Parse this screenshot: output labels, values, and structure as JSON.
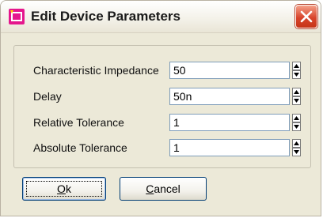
{
  "window": {
    "title": "Edit Device Parameters",
    "close_icon": "close-icon",
    "app_icon": "app-icon"
  },
  "fields": [
    {
      "label": "Characteristic Impedance",
      "value": "50"
    },
    {
      "label": "Delay",
      "value": "50n"
    },
    {
      "label": "Relative Tolerance",
      "value": "1"
    },
    {
      "label": "Absolute Tolerance",
      "value": "1"
    }
  ],
  "buttons": {
    "ok": {
      "mnemonic": "O",
      "rest": "k"
    },
    "cancel": {
      "mnemonic": "C",
      "rest": "ancel"
    }
  },
  "colors": {
    "dialog_bg": "#ece9d8",
    "close_red": "#d8442c",
    "input_border": "#7f9db9"
  }
}
